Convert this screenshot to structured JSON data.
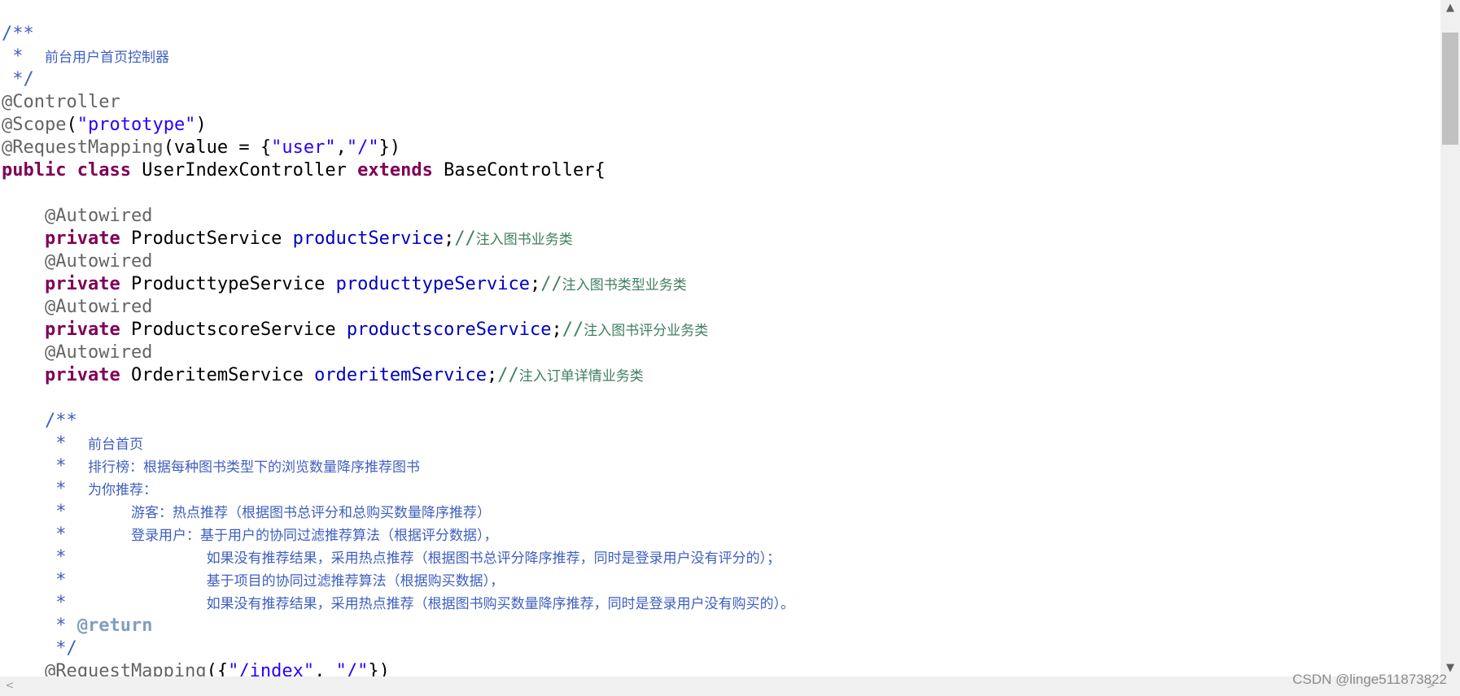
{
  "code_lines": [
    {
      "tokens": [
        {
          "t": "/**",
          "c": "comment"
        }
      ]
    },
    {
      "tokens": [
        {
          "t": " *  ",
          "c": "comment"
        },
        {
          "t": "前台用户首页控制器",
          "c": "comment",
          "cjk": true
        }
      ]
    },
    {
      "tokens": [
        {
          "t": " */",
          "c": "comment"
        }
      ]
    },
    {
      "tokens": [
        {
          "t": "@Controller",
          "c": "anno"
        }
      ]
    },
    {
      "tokens": [
        {
          "t": "@Scope",
          "c": "anno"
        },
        {
          "t": "(",
          "c": "plain"
        },
        {
          "t": "\"prototype\"",
          "c": "str"
        },
        {
          "t": ")",
          "c": "plain"
        }
      ]
    },
    {
      "tokens": [
        {
          "t": "@RequestMapping",
          "c": "anno"
        },
        {
          "t": "(value = {",
          "c": "plain"
        },
        {
          "t": "\"user\"",
          "c": "str"
        },
        {
          "t": ",",
          "c": "plain"
        },
        {
          "t": "\"/\"",
          "c": "str"
        },
        {
          "t": "})",
          "c": "plain"
        }
      ]
    },
    {
      "tokens": [
        {
          "t": "public",
          "c": "kw"
        },
        {
          "t": " ",
          "c": "plain"
        },
        {
          "t": "class",
          "c": "kw"
        },
        {
          "t": " UserIndexController ",
          "c": "plain"
        },
        {
          "t": "extends",
          "c": "kw"
        },
        {
          "t": " BaseController{",
          "c": "plain"
        }
      ]
    },
    {
      "tokens": []
    },
    {
      "tokens": [
        {
          "t": "    @Autowired",
          "c": "anno"
        }
      ]
    },
    {
      "tokens": [
        {
          "t": "    ",
          "c": "plain"
        },
        {
          "t": "private",
          "c": "kw"
        },
        {
          "t": " ProductService ",
          "c": "plain"
        },
        {
          "t": "productService",
          "c": "field"
        },
        {
          "t": ";",
          "c": "plain"
        },
        {
          "t": "//",
          "c": "linecomment"
        },
        {
          "t": "注入图书业务类",
          "c": "linecomment",
          "cjk": true
        }
      ]
    },
    {
      "tokens": [
        {
          "t": "    @Autowired",
          "c": "anno"
        }
      ]
    },
    {
      "tokens": [
        {
          "t": "    ",
          "c": "plain"
        },
        {
          "t": "private",
          "c": "kw"
        },
        {
          "t": " ProducttypeService ",
          "c": "plain"
        },
        {
          "t": "producttypeService",
          "c": "field"
        },
        {
          "t": ";",
          "c": "plain"
        },
        {
          "t": "//",
          "c": "linecomment"
        },
        {
          "t": "注入图书类型业务类",
          "c": "linecomment",
          "cjk": true
        }
      ]
    },
    {
      "tokens": [
        {
          "t": "    @Autowired",
          "c": "anno"
        }
      ]
    },
    {
      "tokens": [
        {
          "t": "    ",
          "c": "plain"
        },
        {
          "t": "private",
          "c": "kw"
        },
        {
          "t": " ProductscoreService ",
          "c": "plain"
        },
        {
          "t": "productscoreService",
          "c": "field"
        },
        {
          "t": ";",
          "c": "plain"
        },
        {
          "t": "//",
          "c": "linecomment"
        },
        {
          "t": "注入图书评分业务类",
          "c": "linecomment",
          "cjk": true
        }
      ]
    },
    {
      "tokens": [
        {
          "t": "    @Autowired",
          "c": "anno"
        }
      ]
    },
    {
      "tokens": [
        {
          "t": "    ",
          "c": "plain"
        },
        {
          "t": "private",
          "c": "kw"
        },
        {
          "t": " OrderitemService ",
          "c": "plain"
        },
        {
          "t": "orderitemService",
          "c": "field"
        },
        {
          "t": ";",
          "c": "plain"
        },
        {
          "t": "//",
          "c": "linecomment"
        },
        {
          "t": "注入订单详情业务类",
          "c": "linecomment",
          "cjk": true
        }
      ]
    },
    {
      "tokens": []
    },
    {
      "tokens": [
        {
          "t": "    /**",
          "c": "comment"
        }
      ]
    },
    {
      "tokens": [
        {
          "t": "     *  ",
          "c": "comment"
        },
        {
          "t": "前台首页",
          "c": "comment",
          "cjk": true
        }
      ]
    },
    {
      "tokens": [
        {
          "t": "     *  ",
          "c": "comment"
        },
        {
          "t": "排行榜：根据每种图书类型下的浏览数量降序推荐图书",
          "c": "comment",
          "cjk": true
        }
      ]
    },
    {
      "tokens": [
        {
          "t": "     *  ",
          "c": "comment"
        },
        {
          "t": "为你推荐：",
          "c": "comment",
          "cjk": true
        }
      ]
    },
    {
      "tokens": [
        {
          "t": "     *      ",
          "c": "comment"
        },
        {
          "t": "游客：热点推荐（根据图书总评分和总购买数量降序推荐）",
          "c": "comment",
          "cjk": true
        }
      ]
    },
    {
      "tokens": [
        {
          "t": "     *      ",
          "c": "comment"
        },
        {
          "t": "登录用户：基于用户的协同过滤推荐算法（根据评分数据），",
          "c": "comment",
          "cjk": true
        }
      ]
    },
    {
      "tokens": [
        {
          "t": "     *             ",
          "c": "comment"
        },
        {
          "t": "如果没有推荐结果，采用热点推荐（根据图书总评分降序推荐，同时是登录用户没有评分的）；",
          "c": "comment",
          "cjk": true
        }
      ]
    },
    {
      "tokens": [
        {
          "t": "     *             ",
          "c": "comment"
        },
        {
          "t": "基于项目的协同过滤推荐算法（根据购买数据），",
          "c": "comment",
          "cjk": true
        }
      ]
    },
    {
      "tokens": [
        {
          "t": "     *             ",
          "c": "comment"
        },
        {
          "t": "如果没有推荐结果，采用热点推荐（根据图书购买数量降序推荐，同时是登录用户没有购买的）。",
          "c": "comment",
          "cjk": true
        }
      ]
    },
    {
      "tokens": [
        {
          "t": "     * ",
          "c": "comment"
        },
        {
          "t": "@return",
          "c": "tag"
        }
      ]
    },
    {
      "tokens": [
        {
          "t": "     */",
          "c": "comment"
        }
      ]
    },
    {
      "tokens": [
        {
          "t": "    @RequestMapping",
          "c": "anno"
        },
        {
          "t": "({",
          "c": "plain"
        },
        {
          "t": "\"/index\"",
          "c": "str"
        },
        {
          "t": ", ",
          "c": "plain"
        },
        {
          "t": "\"/\"",
          "c": "str"
        },
        {
          "t": "})",
          "c": "plain"
        }
      ]
    }
  ],
  "scrollbar": {
    "up_icon": "▲",
    "down_icon": "▼",
    "left_icon": "<",
    "right_icon": ">"
  },
  "watermark": "CSDN @linge511873822"
}
